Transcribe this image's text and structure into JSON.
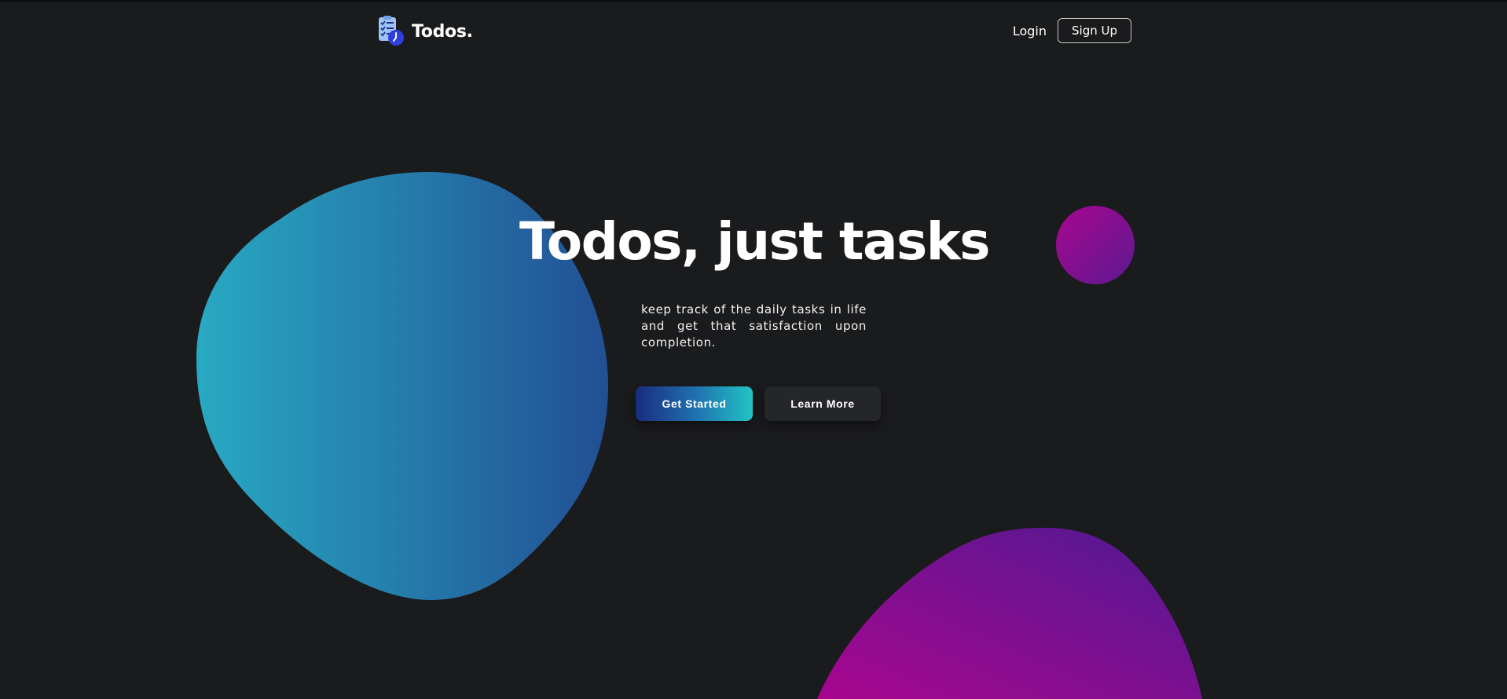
{
  "header": {
    "brand_name": "Todos.",
    "logo_icon": "checklist-clock-icon",
    "nav": {
      "login_label": "Login",
      "signup_label": "Sign Up"
    }
  },
  "hero": {
    "title": "Todos, just tasks",
    "description": "keep track of the daily tasks in life and get that satisfaction upon completion.",
    "primary_button_label": "Get Started",
    "secondary_button_label": "Learn More"
  },
  "colors": {
    "background": "#1a1b1d",
    "blob_cyan": "#28a9c2",
    "blob_blue": "#224f94",
    "accent_magenta": "#a8068f",
    "accent_purple": "#5c1a90",
    "button_primary_start": "#1a2c7f",
    "button_primary_end": "#23c3c5",
    "button_secondary": "#25262a"
  }
}
